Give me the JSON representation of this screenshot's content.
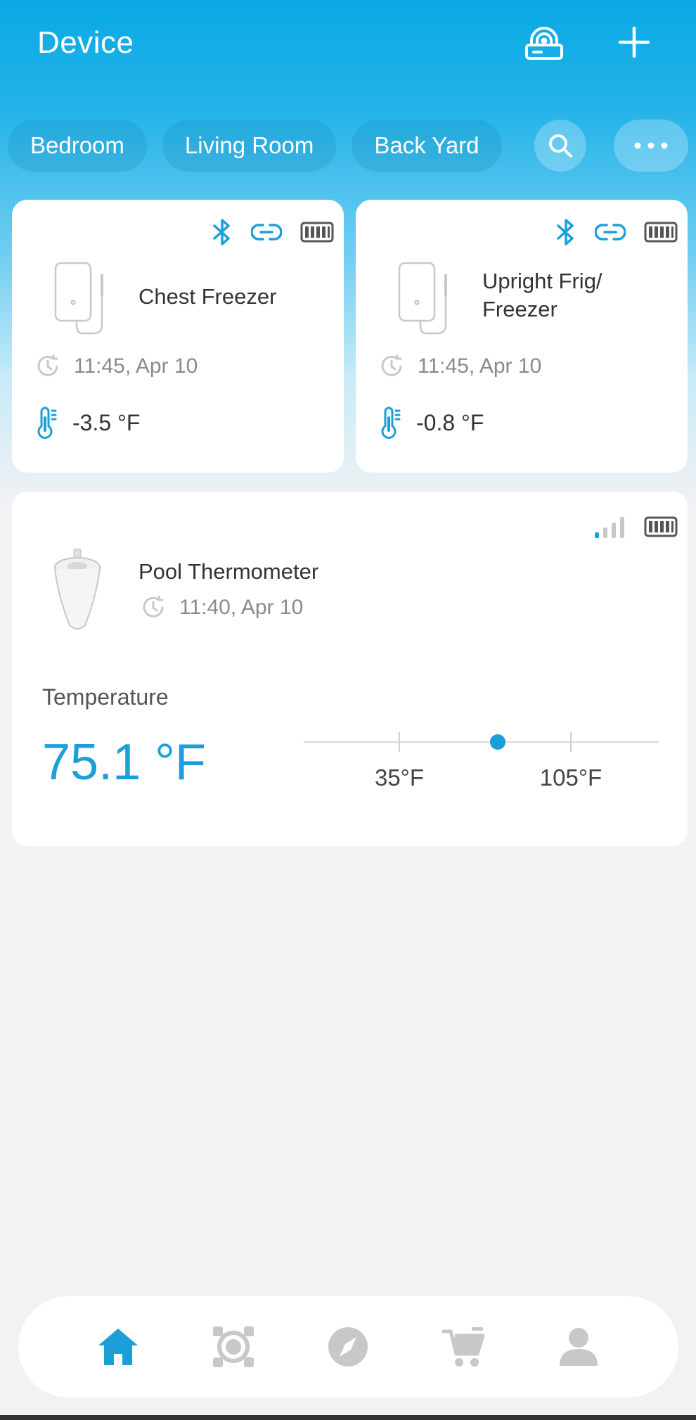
{
  "header": {
    "title": "Device"
  },
  "tabs": [
    {
      "label": "Bedroom"
    },
    {
      "label": "Living Room"
    },
    {
      "label": "Back Yard"
    }
  ],
  "devices": [
    {
      "name": "Chest Freezer",
      "time": "11:45, Apr 10",
      "temp": "-3.5 °F"
    },
    {
      "name_line1": "Upright Frig/",
      "name_line2": "Freezer",
      "time": "11:45, Apr 10",
      "temp": "-0.8 °F"
    }
  ],
  "pool": {
    "name": "Pool Thermometer",
    "time": "11:40, Apr 10",
    "temp_label": "Temperature",
    "temp_value": "75.1 °F",
    "range_low": "35°F",
    "range_high": "105°F",
    "reading": 75.1,
    "range_low_value": 35,
    "range_high_value": 105
  },
  "colors": {
    "accent": "#1a9fd8",
    "header": "#0aa9e4",
    "icon_grey": "#c8c8c8"
  },
  "nav": [
    "home-icon",
    "scan-icon",
    "discover-icon",
    "cart-icon",
    "profile-icon"
  ]
}
